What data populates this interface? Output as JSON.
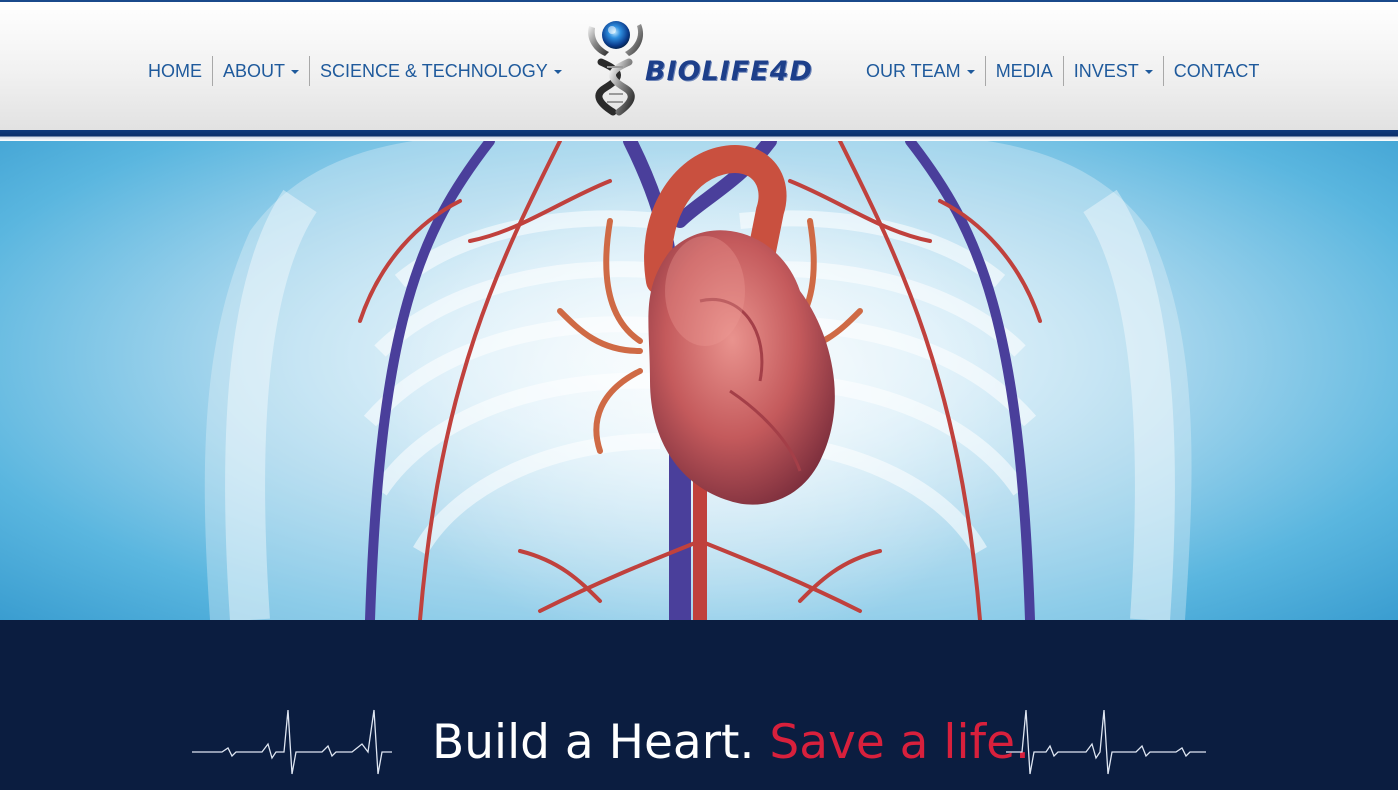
{
  "nav": {
    "left": [
      {
        "label": "HOME",
        "dropdown": false
      },
      {
        "label": "ABOUT",
        "dropdown": true
      },
      {
        "label": "SCIENCE & TECHNOLOGY",
        "dropdown": true
      }
    ],
    "right": [
      {
        "label": "OUR TEAM",
        "dropdown": true
      },
      {
        "label": "MEDIA",
        "dropdown": false
      },
      {
        "label": "INVEST",
        "dropdown": true
      },
      {
        "label": "CONTACT",
        "dropdown": false
      }
    ]
  },
  "logo": {
    "text": "BIOLIFE4D",
    "icon": "dna-helix-icon"
  },
  "hero": {
    "image": "heart-anatomy-illustration"
  },
  "tagline": {
    "part1": "Build a Heart.",
    "part2": "Save a life."
  },
  "colors": {
    "nav_text": "#1f5a9c",
    "brand_blue": "#1d3f8a",
    "footer_bg": "#0b1d40",
    "accent_red": "#d8203c"
  }
}
